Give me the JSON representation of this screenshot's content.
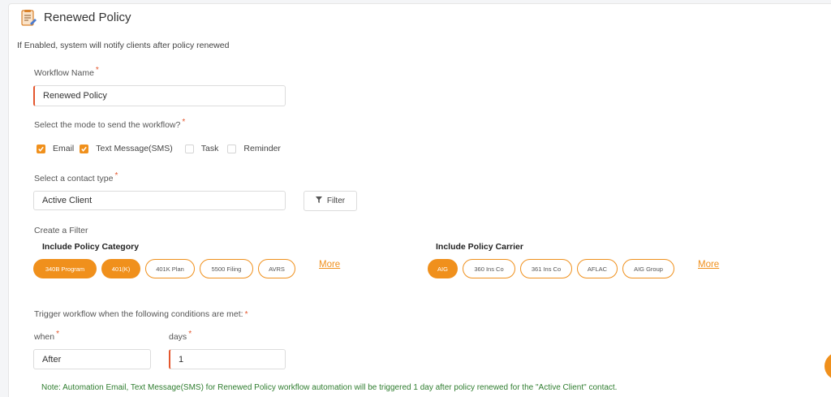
{
  "header": {
    "title": "Renewed Policy",
    "icon": "policy-document-icon"
  },
  "subtitle": "If Enabled, system will notify clients after policy renewed",
  "workflow_name": {
    "label": "Workflow Name",
    "required": "*",
    "value": "Renewed Policy"
  },
  "mode": {
    "label": "Select the mode to send the workflow?",
    "required": "*",
    "options": [
      {
        "label": "Email",
        "checked": true
      },
      {
        "label": "Text Message(SMS)",
        "checked": true
      },
      {
        "label": "Task",
        "checked": false
      },
      {
        "label": "Reminder",
        "checked": false
      }
    ]
  },
  "contact_type": {
    "label": "Select a contact type",
    "required": "*",
    "value": "Active Client",
    "filter_label": "Filter"
  },
  "create_filter": {
    "label": "Create a Filter",
    "category": {
      "title": "Include Policy Category",
      "chips": [
        {
          "label": "340B Program",
          "active": true
        },
        {
          "label": "401(K)",
          "active": true
        },
        {
          "label": "401K Plan",
          "active": false
        },
        {
          "label": "5500 Filing",
          "active": false
        },
        {
          "label": "AVRS",
          "active": false
        }
      ],
      "more": "More"
    },
    "carrier": {
      "title": "Include Policy Carrier",
      "chips": [
        {
          "label": "AIG",
          "active": true
        },
        {
          "label": "360 Ins Co",
          "active": false
        },
        {
          "label": "361 Ins Co",
          "active": false
        },
        {
          "label": "AFLAC",
          "active": false
        },
        {
          "label": "AIG Group",
          "active": false
        }
      ],
      "more": "More"
    }
  },
  "trigger": {
    "label": "Trigger workflow when the following conditions are met:",
    "required": "*",
    "when": {
      "label": "when",
      "required": "*",
      "value": "After"
    },
    "days": {
      "label": "days",
      "required": "*",
      "value": "1"
    }
  },
  "note": "Note: Automation Email, Text Message(SMS) for Renewed Policy workflow automation will be triggered 1 day after policy renewed for the \"Active Client\" contact.",
  "colors": {
    "accent": "#f0901c",
    "required": "#e4572e",
    "note": "#2f7d2f"
  }
}
